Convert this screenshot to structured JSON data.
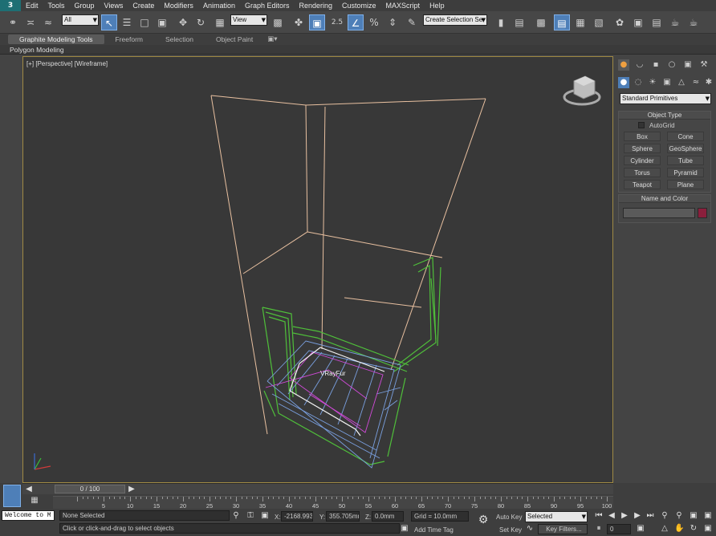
{
  "menu": {
    "logo": "3",
    "items": [
      "Edit",
      "Tools",
      "Group",
      "Views",
      "Create",
      "Modifiers",
      "Animation",
      "Graph Editors",
      "Rendering",
      "Customize",
      "MAXScript",
      "Help"
    ]
  },
  "toolbar": {
    "filter": "All",
    "refcoord": "View",
    "snap_value": "2.5",
    "named_selection": "Create Selection Se"
  },
  "ribbon": {
    "tabs": [
      "Graphite Modeling Tools",
      "Freeform",
      "Selection",
      "Object Paint"
    ],
    "sub": "Polygon Modeling"
  },
  "viewport": {
    "label": "[+] [Perspective] [Wireframe]",
    "object_label": "VRayFur"
  },
  "command_panel": {
    "category": "Standard Primitives",
    "object_type_title": "Object Type",
    "autogrid": "AutoGrid",
    "buttons": [
      "Box",
      "Cone",
      "Sphere",
      "GeoSphere",
      "Cylinder",
      "Tube",
      "Torus",
      "Pyramid",
      "Teapot",
      "Plane"
    ],
    "name_color_title": "Name and Color",
    "swatch_color": "#8a1f3c"
  },
  "timeline": {
    "frame": "0 / 100",
    "ticks": [
      "5",
      "10",
      "15",
      "20",
      "25",
      "30",
      "35",
      "40",
      "45",
      "50",
      "55",
      "60",
      "65",
      "70",
      "75",
      "80",
      "85",
      "90",
      "95",
      "100"
    ]
  },
  "status": {
    "script": "Welcome to M",
    "selection": "None Selected",
    "prompt": "Click or click-and-drag to select objects",
    "x_label": "X:",
    "x": "-2168.993r",
    "y_label": "Y:",
    "y": "355.705mm",
    "z_label": "Z:",
    "z": "0.0mm",
    "grid": "Grid = 10.0mm",
    "add_time_tag": "Add Time Tag",
    "auto_key": "Auto Key",
    "set_key": "Set Key",
    "selected": "Selected",
    "key_filters": "Key Filters...",
    "frame_field": "0"
  }
}
